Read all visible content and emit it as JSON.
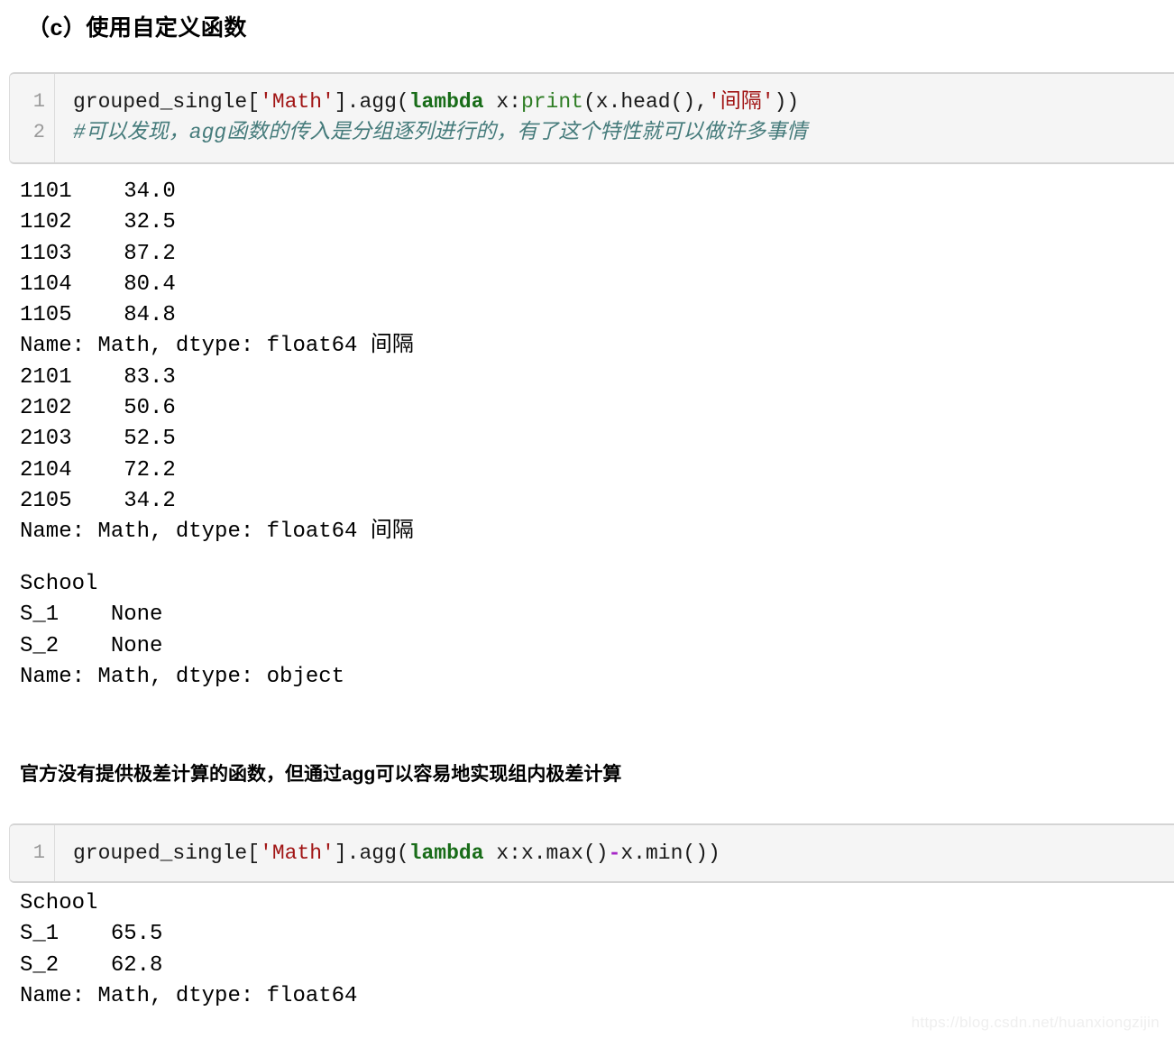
{
  "page": {
    "section_title": "（c）使用自定义函数",
    "body_heading": "官方没有提供极差计算的函数，但通过agg可以容易地实现组内极差计算",
    "watermark": "https://blog.csdn.net/huanxiongzijin"
  },
  "code_block_1": {
    "line_numbers": [
      "1",
      "2"
    ],
    "line1": {
      "part1": "grouped_single[",
      "string1": "'Math'",
      "part2": "].agg(",
      "keyword": "lambda",
      "part3": " x:",
      "func": "print",
      "part4": "(x.head(),",
      "string2": "'间隔'",
      "part5": "))"
    },
    "line2_comment": "#可以发现，agg函数的传入是分组逐列进行的，有了这个特性就可以做许多事情"
  },
  "output_1": {
    "rows": [
      "1101    34.0",
      "1102    32.5",
      "1103    87.2",
      "1104    80.4",
      "1105    84.8",
      "Name: Math, dtype: float64 间隔",
      "2101    83.3",
      "2102    50.6",
      "2103    52.5",
      "2104    72.2",
      "2105    34.2",
      "Name: Math, dtype: float64 间隔"
    ]
  },
  "output_2": {
    "rows": [
      "School",
      "S_1    None",
      "S_2    None",
      "Name: Math, dtype: object"
    ]
  },
  "code_block_2": {
    "line_numbers": [
      "1"
    ],
    "line1": {
      "part1": "grouped_single[",
      "string1": "'Math'",
      "part2": "].agg(",
      "keyword": "lambda",
      "part3": " x:x.max()",
      "op": "-",
      "part4": "x.min())"
    }
  },
  "output_3": {
    "rows": [
      "School",
      "S_1    65.5",
      "S_2    62.8",
      "Name: Math, dtype: float64"
    ]
  }
}
